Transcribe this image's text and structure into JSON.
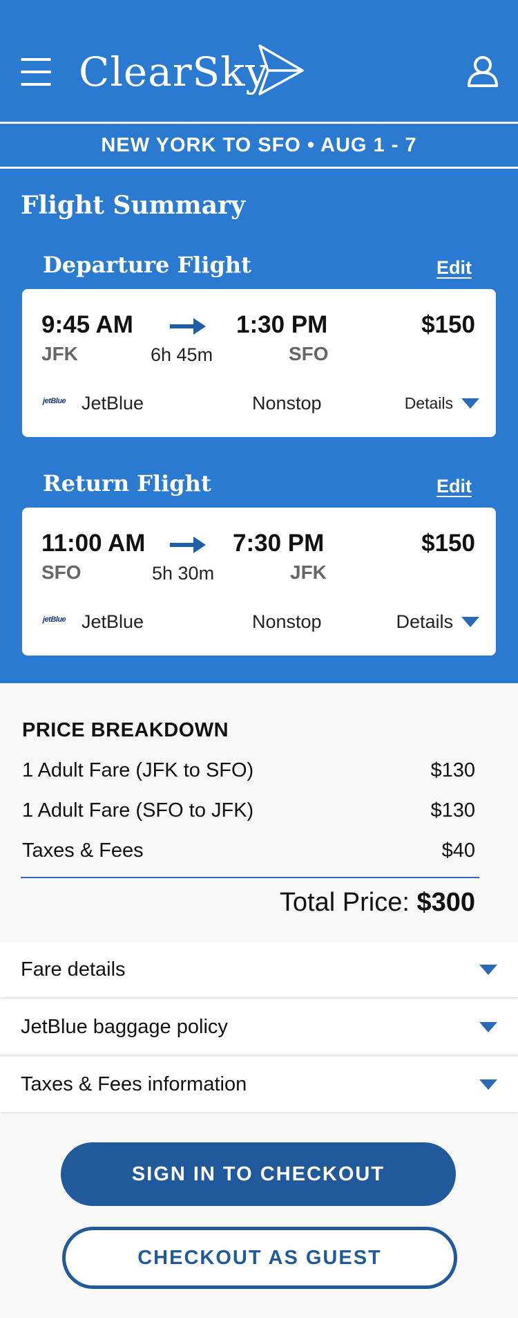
{
  "app": {
    "title": "ClearSky"
  },
  "route": {
    "label": "NEW YORK TO SFO  •  AUG 1 - 7"
  },
  "summary": {
    "title": "Flight Summary"
  },
  "departure": {
    "section_title": "Departure Flight",
    "edit_label": "Edit",
    "depart_time": "9:45 AM",
    "arrive_time": "1:30 PM",
    "from": "JFK",
    "to": "SFO",
    "duration": "6h 45m",
    "price": "$150",
    "airline_logo_text": "jetBlue",
    "airline": "JetBlue",
    "stops": "Nonstop",
    "details_label": "Details"
  },
  "return": {
    "section_title": "Return Flight",
    "edit_label": "Edit",
    "depart_time": "11:00 AM",
    "arrive_time": "7:30 PM",
    "from": "SFO",
    "to": "JFK",
    "duration": "5h 30m",
    "price": "$150",
    "airline_logo_text": "jetBlue",
    "airline": "JetBlue",
    "stops": "Nonstop",
    "details_label": "Details"
  },
  "price_breakdown": {
    "title": "PRICE BREAKDOWN",
    "rows": [
      {
        "label": "1 Adult Fare (JFK to SFO)",
        "value": "$130"
      },
      {
        "label": "1 Adult Fare (SFO to JFK)",
        "value": "$130"
      },
      {
        "label": "Taxes & Fees",
        "value": "$40"
      }
    ],
    "total_label": "Total Price:",
    "total_value": "$300"
  },
  "accordions": [
    {
      "label": "Fare details"
    },
    {
      "label": "JetBlue baggage policy"
    },
    {
      "label": "Taxes & Fees information"
    }
  ],
  "actions": {
    "sign_in_label": "SIGN IN TO CHECKOUT",
    "guest_label": "CHECKOUT AS GUEST"
  },
  "colors": {
    "brand": "#2a7ad1",
    "button": "#215a9c",
    "accent": "#2a6ab8"
  },
  "icons": {
    "menu": "hamburger-menu-icon",
    "logo": "paper-plane-icon",
    "user": "user-icon",
    "arrow": "right-arrow-icon",
    "expand": "chevron-down-icon"
  }
}
